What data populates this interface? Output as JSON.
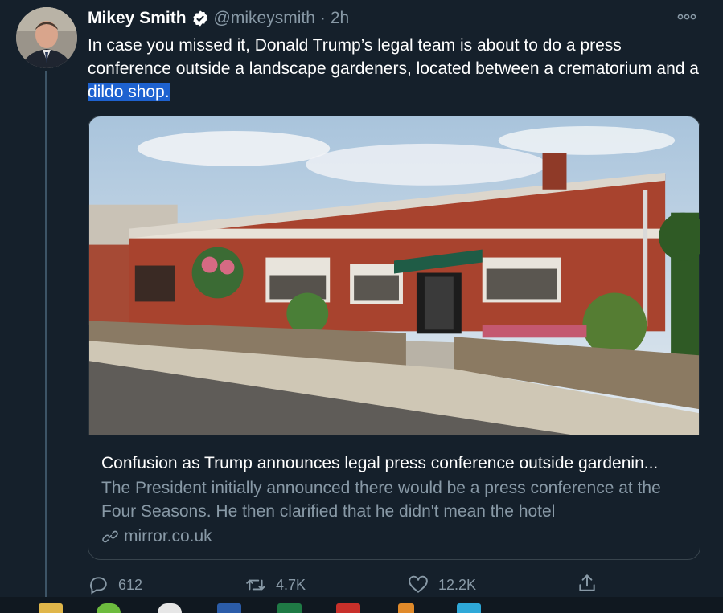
{
  "tweet": {
    "display_name": "Mikey Smith",
    "handle": "@mikeysmith",
    "separator": "·",
    "time": "2h",
    "text_plain": "In case you missed it, Donald Trump’s legal team is about to do a press conference outside a landscape gardeners, located between a crematorium and a ",
    "text_highlight": "dildo shop."
  },
  "card": {
    "title": "Confusion as Trump announces legal press conference outside gardenin...",
    "description": "The President initially announced there would be a press conference at the Four Seasons. He then clarified that he didn't mean the hotel",
    "domain": "mirror.co.uk"
  },
  "actions": {
    "reply_count": "612",
    "retweet_count": "4.7K",
    "like_count": "12.2K"
  },
  "colors": {
    "background": "#15202b",
    "secondary_text": "#8899a6",
    "border": "#38444d",
    "highlight": "#1e62d0",
    "verified": "#ffffff"
  },
  "icons": [
    "verified-badge-icon",
    "more-icon",
    "link-icon",
    "reply-icon",
    "retweet-icon",
    "like-icon",
    "share-icon"
  ]
}
